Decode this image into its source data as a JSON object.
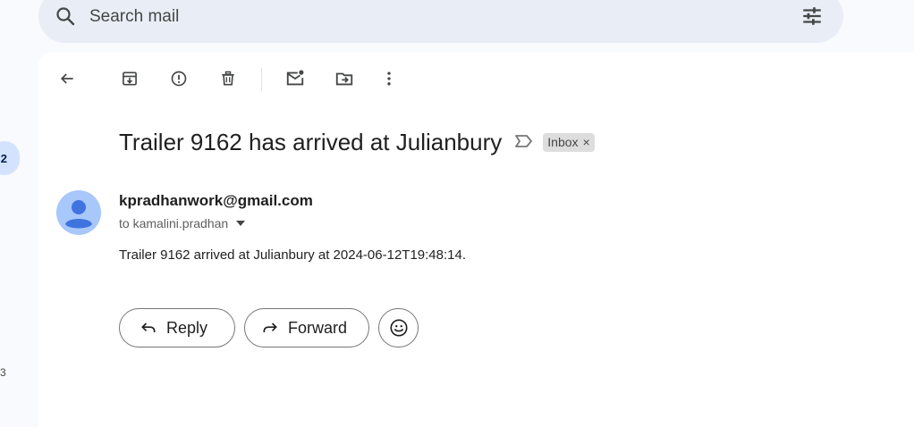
{
  "search": {
    "placeholder": "Search mail"
  },
  "rail": {
    "badge_count": "2",
    "secondary_count": "3"
  },
  "message": {
    "subject": "Trailer 9162 has arrived at Julianbury",
    "label_chip": "Inbox",
    "label_remove": "×",
    "sender": "kpradhanwork@gmail.com",
    "recipient": "to kamalini.pradhan",
    "body": "Trailer 9162 arrived at Julianbury at 2024-06-12T19:48:14."
  },
  "actions": {
    "reply_label": "Reply",
    "forward_label": "Forward"
  },
  "colors": {
    "background": "#f8fafd",
    "search_bg": "#e9eef6",
    "avatar_bg": "#a8c7fa",
    "avatar_fg": "#3f74e0",
    "chip_bg": "#dddddd"
  },
  "icons": [
    "search-icon",
    "filter-icon",
    "back-arrow-icon",
    "archive-icon",
    "report-spam-icon",
    "delete-icon",
    "mark-unread-icon",
    "move-to-icon",
    "more-options-icon",
    "importance-marker-icon",
    "expand-caret-icon",
    "reply-icon",
    "forward-icon",
    "emoji-reaction-icon"
  ]
}
